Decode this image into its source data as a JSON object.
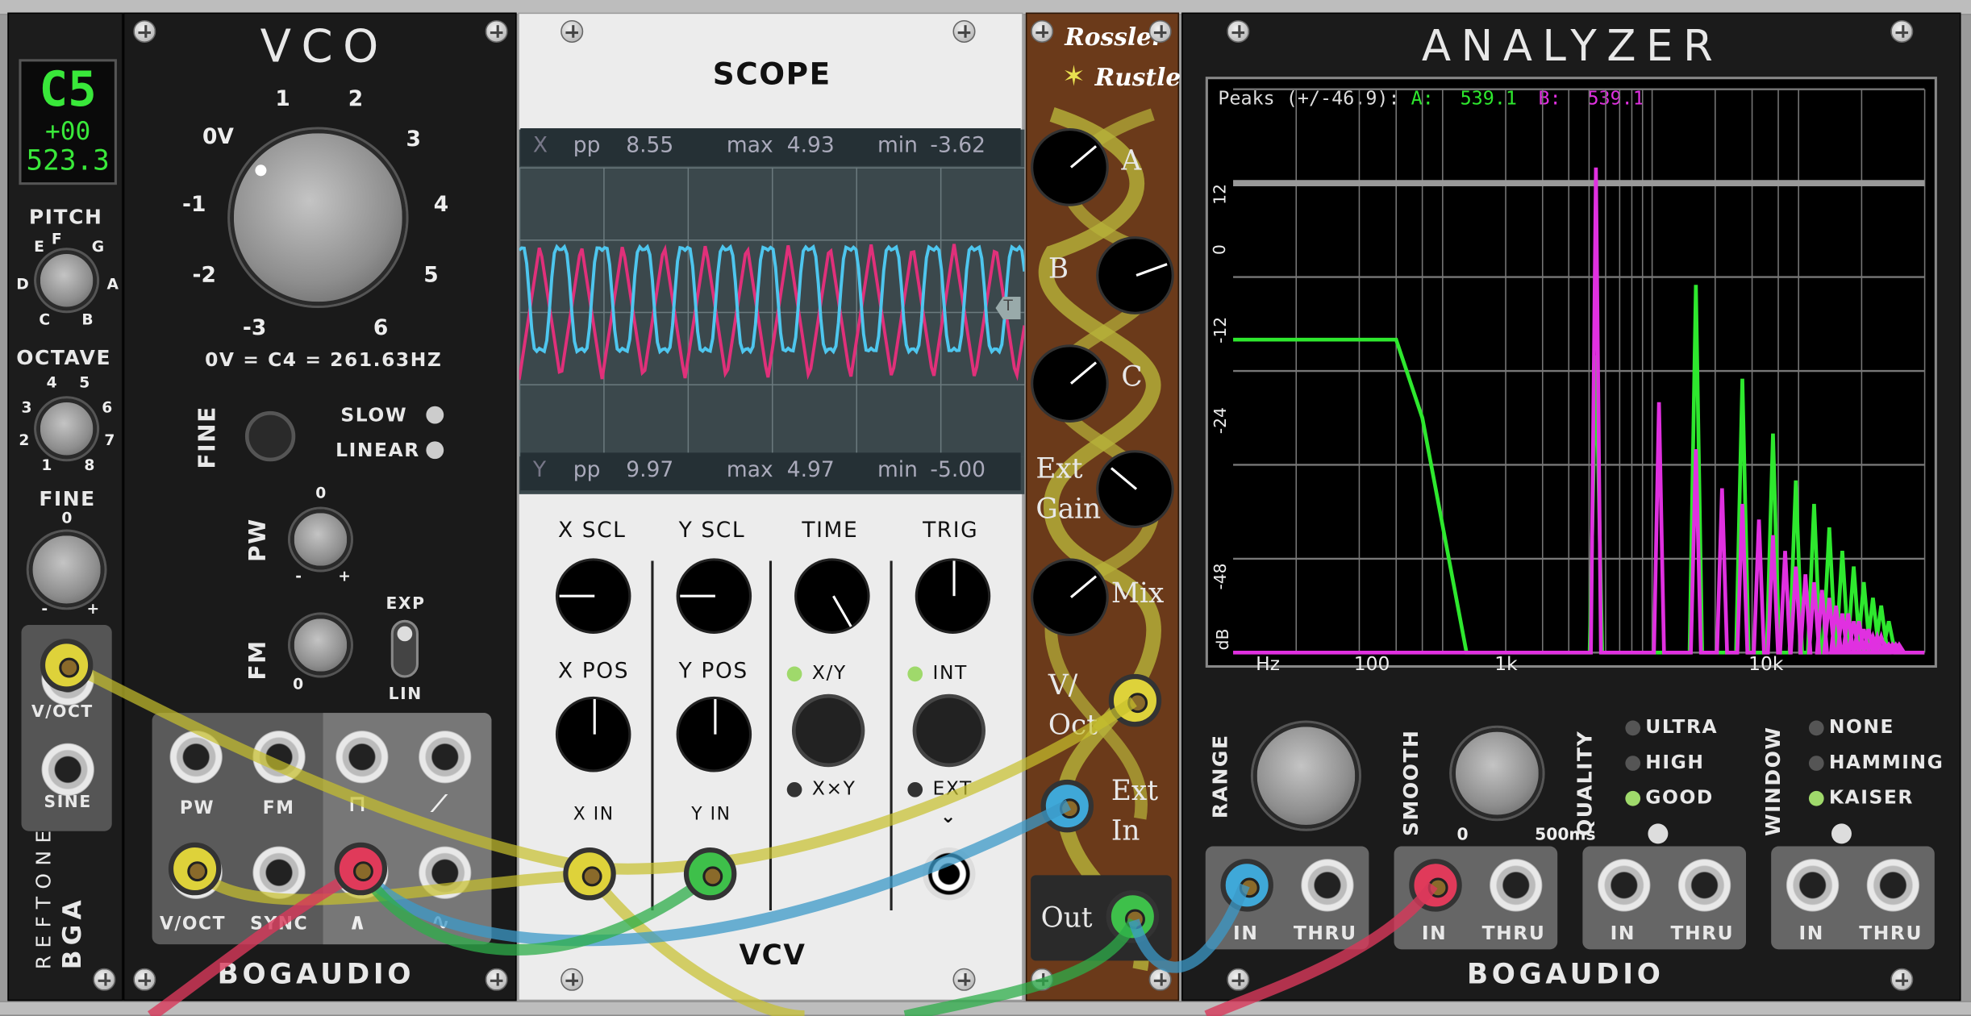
{
  "reftone": {
    "note": "C5",
    "cents": "+00",
    "freq": "523.3",
    "pitch_label": "PITCH",
    "pitch_notes": [
      "E",
      "F",
      "G",
      "D",
      "A",
      "C",
      "B"
    ],
    "octave_label": "OCTAVE",
    "octave_values": [
      "4",
      "5",
      "3",
      "6",
      "2",
      "7",
      "1",
      "8"
    ],
    "fine_label": "FINE",
    "fine_zero": "0",
    "fine_minus": "-",
    "fine_plus": "+",
    "voct_label": "V/OCT",
    "sine_label": "SINE",
    "brand_top": "REFTONE",
    "brand_bottom": "BGA"
  },
  "vco": {
    "title": "VCO",
    "scale": [
      "0V",
      "1",
      "2",
      "3",
      "4",
      "5",
      "6",
      "-1",
      "-2",
      "-3"
    ],
    "caption": "0V = C4 = 261.63HZ",
    "fine_label": "FINE",
    "slow_label": "SLOW",
    "linear_label": "LINEAR",
    "pw_label": "PW",
    "pw_zero": "0",
    "pw_minus": "-",
    "pw_plus": "+",
    "fm_label": "FM",
    "fm_zero": "0",
    "exp_label": "EXP",
    "lin_label": "LIN",
    "jack_labels": [
      "PW",
      "FM",
      "V/OCT",
      "SYNC"
    ],
    "brand": "BOGAUDIO"
  },
  "scope": {
    "title": "SCOPE",
    "x_row": {
      "ch": "X",
      "pp": "pp",
      "pp_val": "8.55",
      "max": "max",
      "max_val": "4.93",
      "min": "min",
      "min_val": "-3.62"
    },
    "y_row": {
      "ch": "Y",
      "pp": "pp",
      "pp_val": "9.97",
      "max": "max",
      "max_val": "4.97",
      "min": "min",
      "min_val": "-5.00"
    },
    "trig_marker": "T",
    "knob_labels": [
      "X SCL",
      "Y SCL",
      "TIME",
      "TRIG",
      "X POS",
      "Y POS"
    ],
    "xy_label": "X/Y",
    "xxy_label": "X×Y",
    "int_label": "INT",
    "ext_label": "EXT",
    "xin_label": "X IN",
    "yin_label": "Y IN",
    "brand": "VCV",
    "colors": {
      "x": "#e0307a",
      "y": "#4ec6ee"
    }
  },
  "rossler": {
    "title1": "Rossler",
    "title2": "Rustler",
    "a": "A",
    "b": "B",
    "c": "C",
    "ext_gain": "Ext Gain",
    "mix": "Mix",
    "voct": "V/ Oct",
    "ext_in": "Ext In",
    "out": "Out"
  },
  "analyzer": {
    "title": "ANALYZER",
    "peaks_label": "Peaks (+/-46.9):",
    "a_label": "A:",
    "a_val": "539.1",
    "b_label": "B:",
    "b_val": "539.1",
    "y_ticks": [
      "12",
      "0",
      "-12",
      "-24",
      "-48",
      "dB"
    ],
    "x_ticks": [
      "Hz",
      "100",
      "1k",
      "10k"
    ],
    "range_label": "RANGE",
    "smooth_label": "SMOOTH",
    "smooth_min": "0",
    "smooth_max": "500ms",
    "quality_label": "QUALITY",
    "quality_opts": [
      "ULTRA",
      "HIGH",
      "GOOD"
    ],
    "window_label": "WINDOW",
    "window_opts": [
      "NONE",
      "HAMMING",
      "KAISER"
    ],
    "in_label": "IN",
    "thru_label": "THRU",
    "brand": "BOGAUDIO",
    "colors": {
      "a": "#2ee82e",
      "b": "#e030e0"
    }
  }
}
